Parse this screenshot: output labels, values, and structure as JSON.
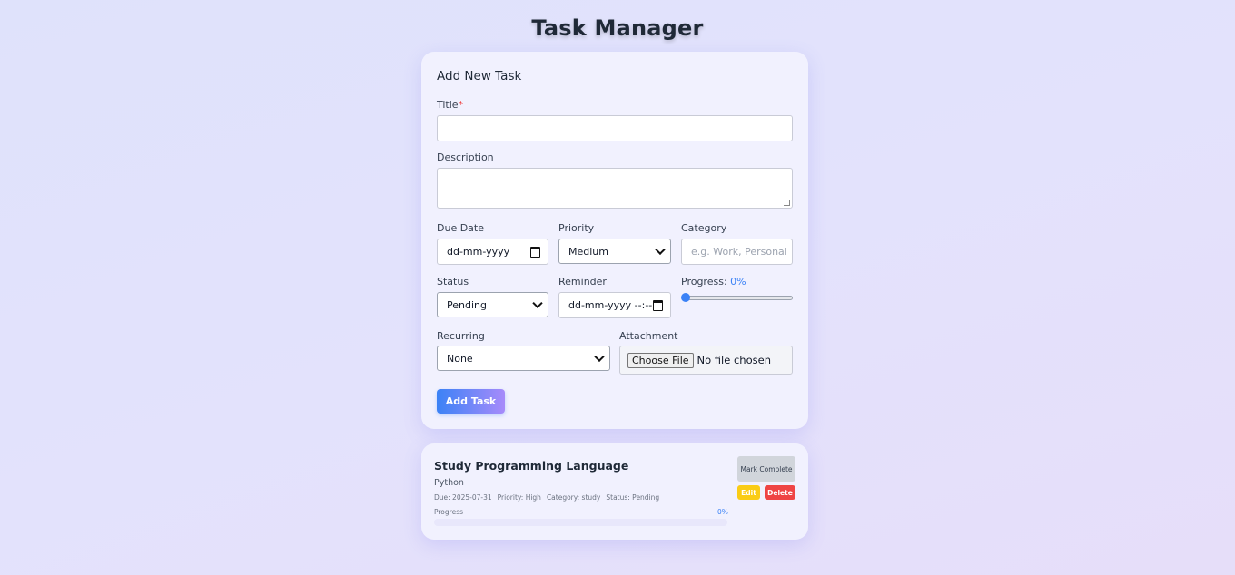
{
  "app": {
    "title": "Task Manager"
  },
  "form": {
    "heading": "Add New Task",
    "title_label": "Title",
    "required_mark": "*",
    "title_value": "",
    "description_label": "Description",
    "description_value": "",
    "due_date_label": "Due Date",
    "due_date_value": "dd-mm-yyyy",
    "priority_label": "Priority",
    "priority_value": "Medium",
    "category_label": "Category",
    "category_placeholder": "e.g. Work, Personal",
    "status_label": "Status",
    "status_value": "Pending",
    "reminder_label": "Reminder",
    "reminder_value": "dd-mm-yyyy --:--",
    "progress_label": "Progress:",
    "progress_value": "0%",
    "progress_fraction": 0,
    "recurring_label": "Recurring",
    "recurring_value": "None",
    "attachment_label": "Attachment",
    "attachment_button": "Choose File",
    "attachment_status": "No file chosen",
    "submit_label": "Add Task"
  },
  "tasks": [
    {
      "title": "Study Programming Language",
      "description": "Python",
      "due": "Due: 2025-07-31",
      "priority": "Priority: High",
      "category": "Category: study",
      "status": "Status: Pending",
      "progress_label": "Progress",
      "progress_value": "0%",
      "progress_fraction": 0,
      "mark_complete_label": "Mark Complete",
      "edit_label": "Edit",
      "delete_label": "Delete"
    }
  ],
  "colors": {
    "accent": "#3b82f6",
    "edit": "#facc15",
    "delete": "#ef4444",
    "required": "#ef4444"
  }
}
